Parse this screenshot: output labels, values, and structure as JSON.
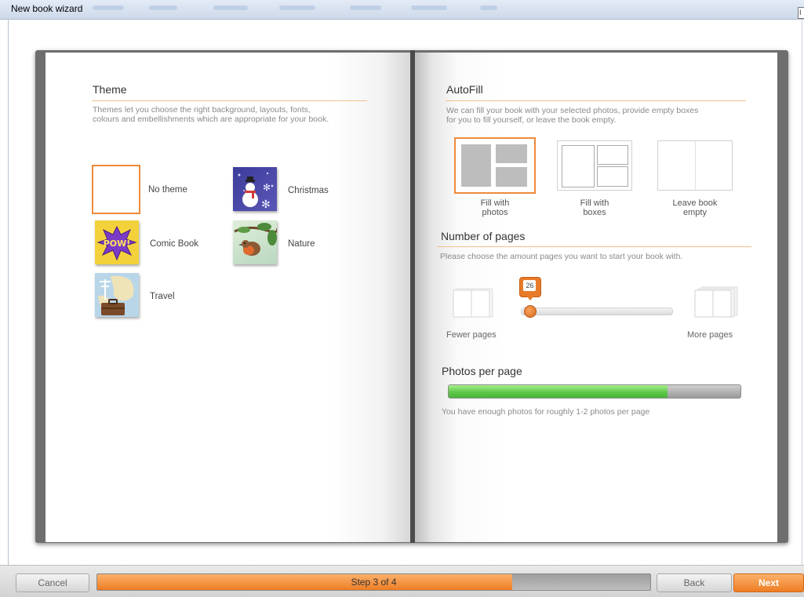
{
  "window": {
    "title": "New book wizard",
    "corner_button": "I"
  },
  "left_page": {
    "theme": {
      "title": "Theme",
      "description_line1": "Themes let you choose the right background, layouts, fonts,",
      "description_line2": "colours and embellishments which are appropriate for your book.",
      "items": [
        {
          "label": "No theme",
          "selected": true
        },
        {
          "label": "Christmas",
          "selected": false
        },
        {
          "label": "Comic Book",
          "selected": false
        },
        {
          "label": "Nature",
          "selected": false
        },
        {
          "label": "Travel",
          "selected": false
        }
      ],
      "comic_badge": "POW!"
    }
  },
  "right_page": {
    "autofill": {
      "title": "AutoFill",
      "description_line1": "We can fill your book with your selected photos, provide empty boxes",
      "description_line2": "for you to fill yourself, or leave the book empty.",
      "options": [
        {
          "label_line1": "Fill with",
          "label_line2": "photos",
          "selected": true
        },
        {
          "label_line1": "Fill with",
          "label_line2": "boxes",
          "selected": false
        },
        {
          "label_line1": "Leave book",
          "label_line2": "empty",
          "selected": false
        }
      ]
    },
    "pages": {
      "title": "Number of pages",
      "description": "Please choose the amount pages you want to start your book with.",
      "slider_value": "26",
      "slider_fraction": 0.03,
      "fewer_label": "Fewer pages",
      "more_label": "More pages"
    },
    "photos_per_page": {
      "title": "Photos per page",
      "fill_fraction": 0.75,
      "message": "You have enough photos for roughly 1-2 photos per page"
    }
  },
  "footer": {
    "cancel_label": "Cancel",
    "step_text": "Step 3 of 4",
    "step_fraction": 0.75,
    "back_label": "Back",
    "next_label": "Next"
  },
  "colors": {
    "accent": "#ee7d24",
    "progress_green": "#5fc94a"
  }
}
